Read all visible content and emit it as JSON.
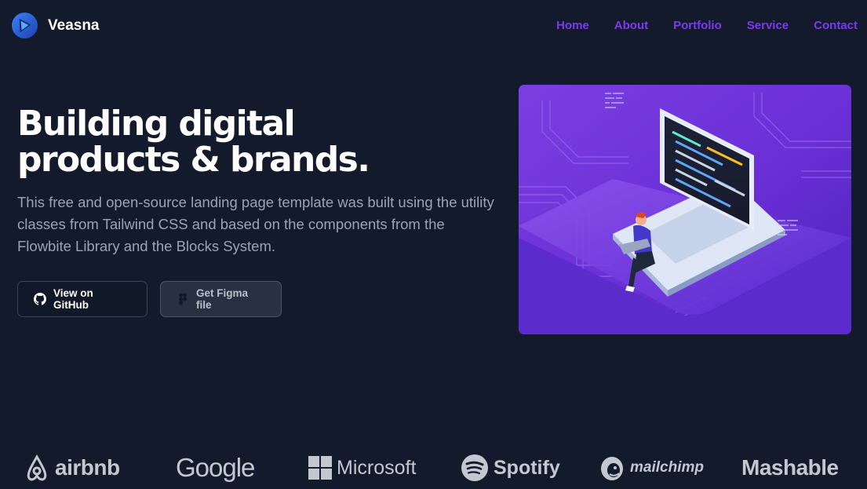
{
  "nav": {
    "brand": "Veasna",
    "items": [
      {
        "label": "Home"
      },
      {
        "label": "About"
      },
      {
        "label": "Portfolio"
      },
      {
        "label": "Service"
      },
      {
        "label": "Contact"
      }
    ]
  },
  "hero": {
    "title_line1": "Building digital",
    "title_line2": "products & brands.",
    "subtitle": "This free and open-source landing page template was built using the utility classes from Tailwind CSS and based on the components from the Flowbite Library and the Blocks System.",
    "buttons": {
      "github": {
        "label": "View on GitHub",
        "icon": "github-icon"
      },
      "figma": {
        "label": "Get Figma file",
        "icon": "figma-icon"
      }
    }
  },
  "illustration": {
    "subject": "person-sitting-on-laptop"
  },
  "logos": [
    {
      "name": "airbnb",
      "icon": "airbnb-icon"
    },
    {
      "name": "Google"
    },
    {
      "name": "Microsoft",
      "icon": "microsoft-icon"
    },
    {
      "name": "Spotify",
      "icon": "spotify-icon"
    },
    {
      "name": "mailchimp",
      "icon": "mailchimp-icon"
    },
    {
      "name": "Mashable"
    }
  ],
  "colors": {
    "background": "#131a2b",
    "accent": "#7c3aed",
    "text_muted": "#9aa3b5",
    "logo_gray": "#c3c7cf"
  }
}
